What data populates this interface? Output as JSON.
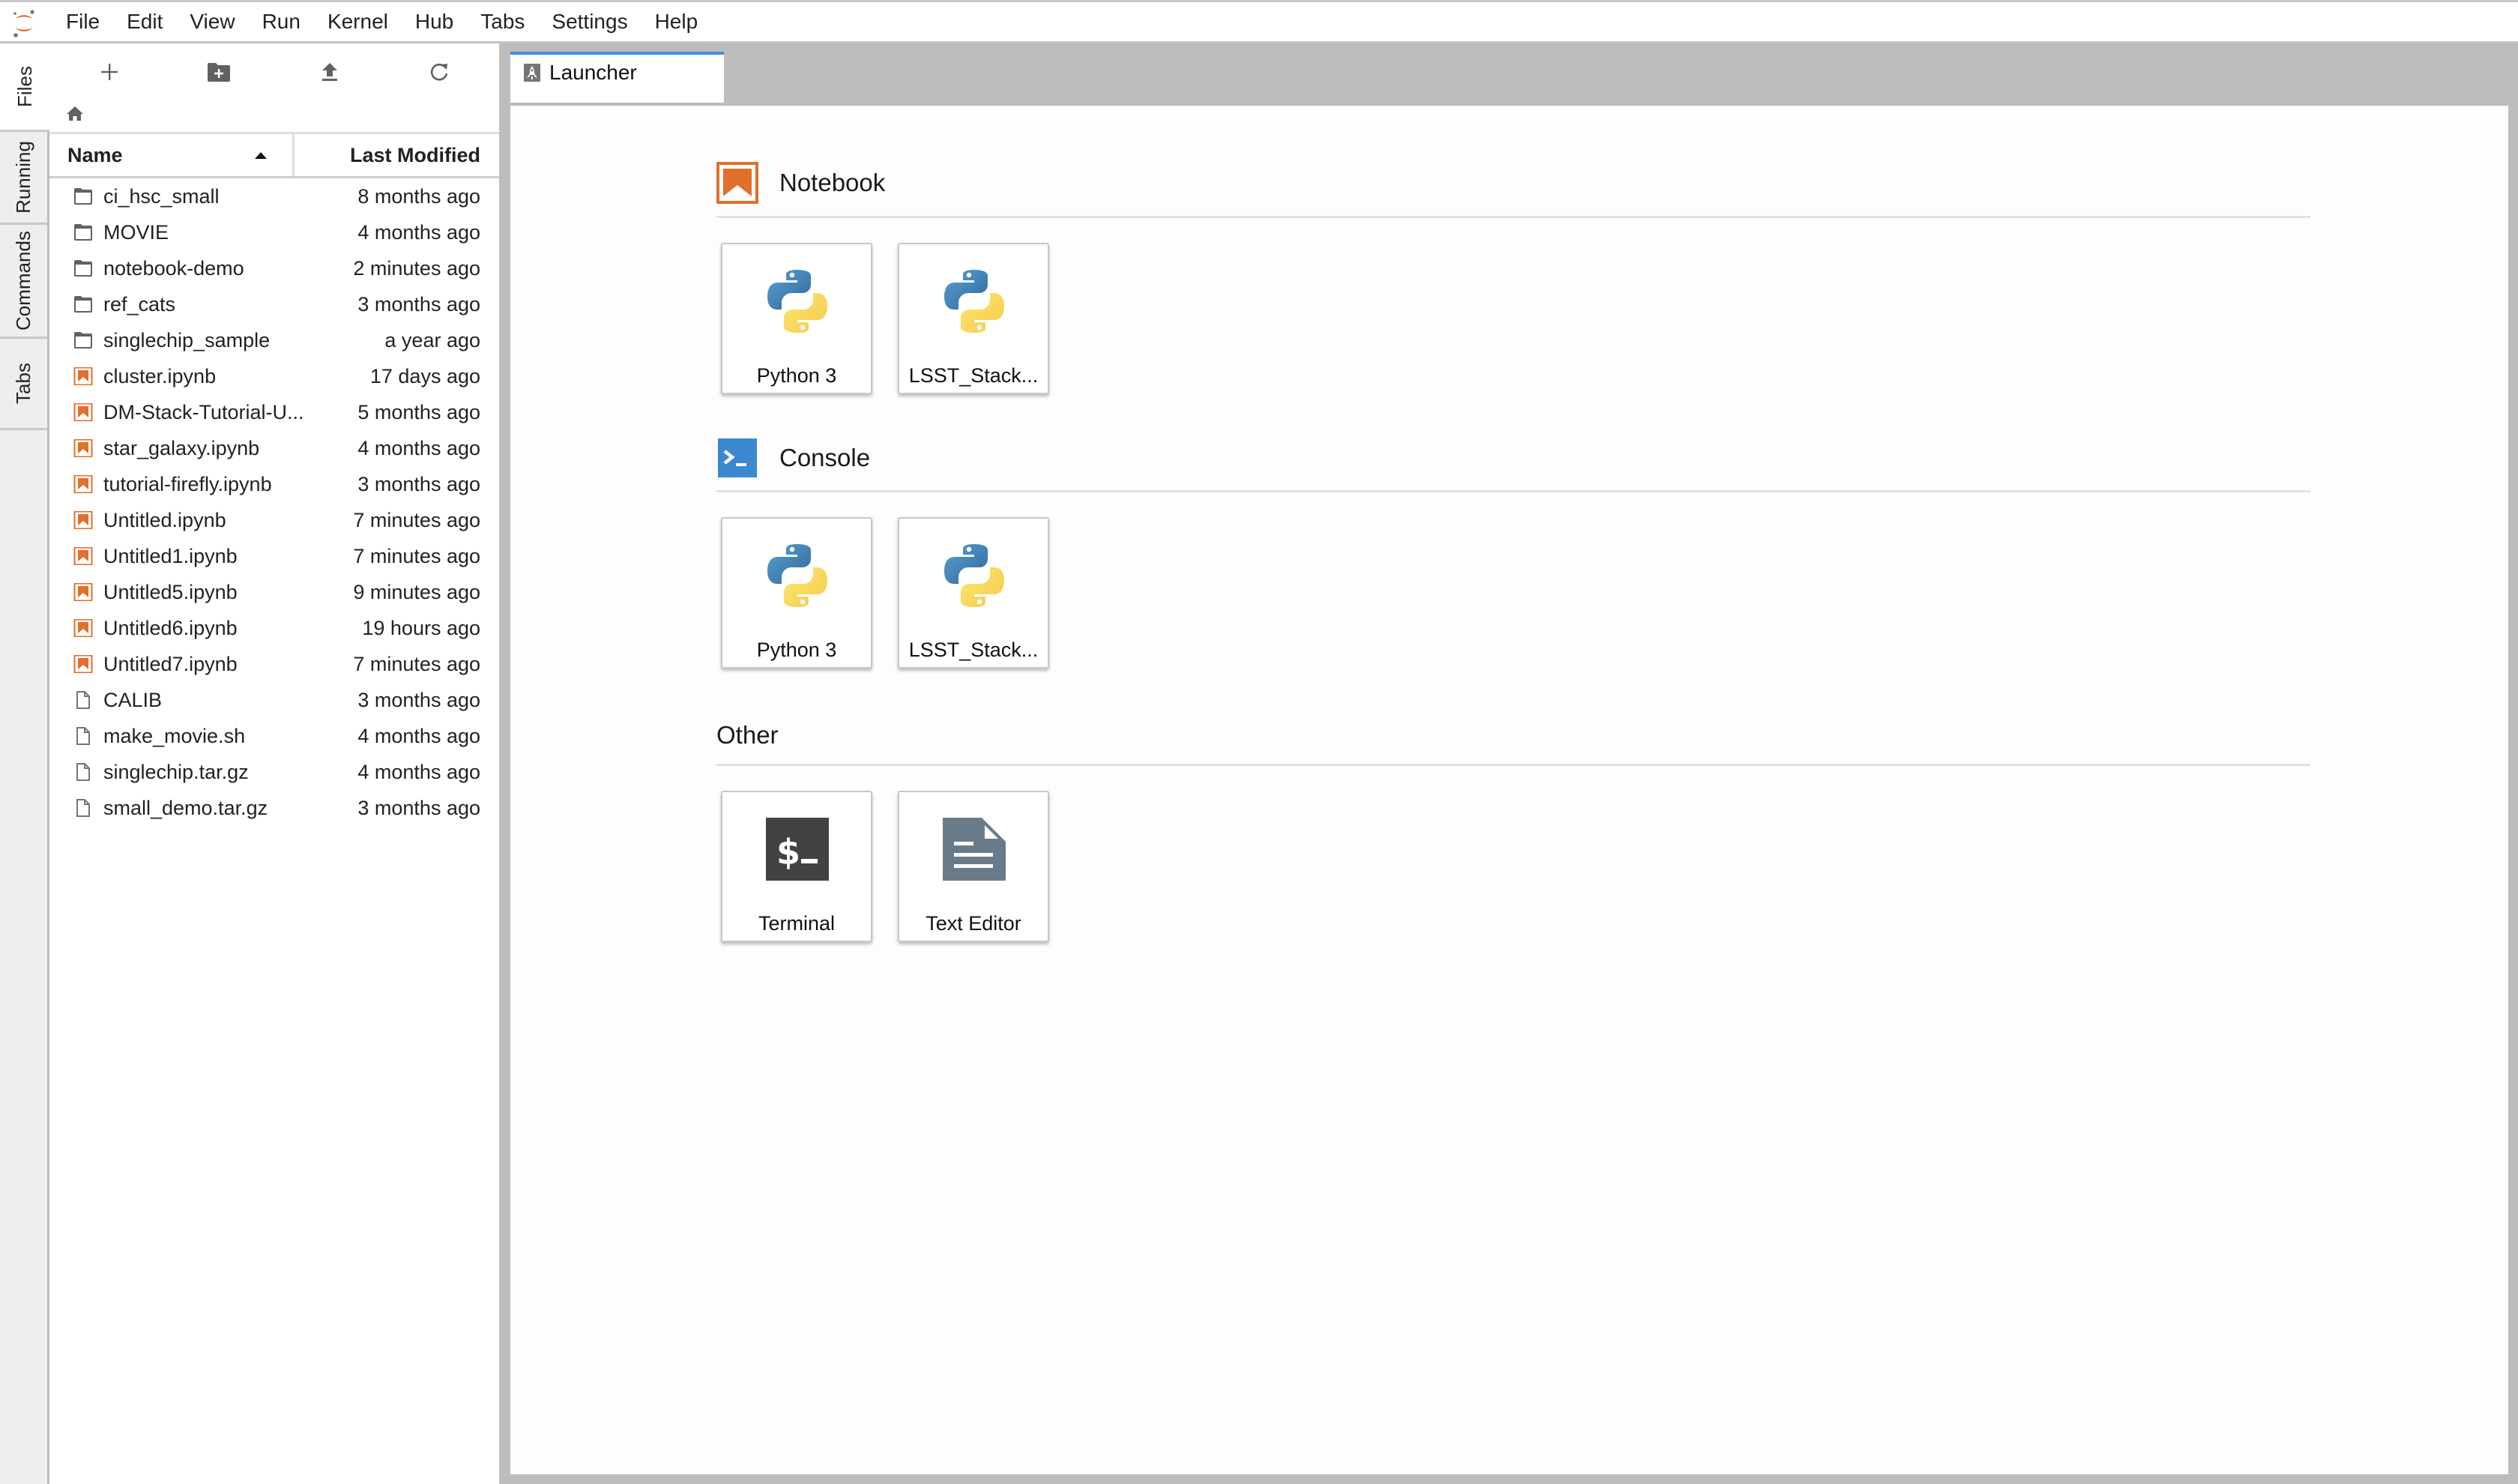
{
  "app": {
    "logo": "jupyter-logo",
    "menu": [
      "File",
      "Edit",
      "View",
      "Run",
      "Kernel",
      "Hub",
      "Tabs",
      "Settings",
      "Help"
    ]
  },
  "side_tabs": [
    {
      "label": "Files",
      "active": true
    },
    {
      "label": "Running",
      "active": false
    },
    {
      "label": "Commands",
      "active": false
    },
    {
      "label": "Tabs",
      "active": false
    }
  ],
  "file_browser": {
    "toolbar": {
      "new_launcher": "plus-icon",
      "new_folder": "new-folder-icon",
      "upload": "upload-icon",
      "refresh": "refresh-icon"
    },
    "breadcrumb": "home-icon",
    "columns": {
      "name": "Name",
      "last_modified": "Last Modified",
      "sort": "ascending"
    },
    "files": [
      {
        "name": "ci_hsc_small",
        "type": "folder",
        "modified": "8 months ago"
      },
      {
        "name": "MOVIE",
        "type": "folder",
        "modified": "4 months ago"
      },
      {
        "name": "notebook-demo",
        "type": "folder",
        "modified": "2 minutes ago"
      },
      {
        "name": "ref_cats",
        "type": "folder",
        "modified": "3 months ago"
      },
      {
        "name": "singlechip_sample",
        "type": "folder",
        "modified": "a year ago"
      },
      {
        "name": "cluster.ipynb",
        "type": "notebook",
        "modified": "17 days ago"
      },
      {
        "name": "DM-Stack-Tutorial-U...",
        "type": "notebook",
        "modified": "5 months ago"
      },
      {
        "name": "star_galaxy.ipynb",
        "type": "notebook",
        "modified": "4 months ago"
      },
      {
        "name": "tutorial-firefly.ipynb",
        "type": "notebook",
        "modified": "3 months ago"
      },
      {
        "name": "Untitled.ipynb",
        "type": "notebook",
        "modified": "7 minutes ago"
      },
      {
        "name": "Untitled1.ipynb",
        "type": "notebook",
        "modified": "7 minutes ago"
      },
      {
        "name": "Untitled5.ipynb",
        "type": "notebook",
        "modified": "9 minutes ago"
      },
      {
        "name": "Untitled6.ipynb",
        "type": "notebook",
        "modified": "19 hours ago"
      },
      {
        "name": "Untitled7.ipynb",
        "type": "notebook",
        "modified": "7 minutes ago"
      },
      {
        "name": "CALIB",
        "type": "file",
        "modified": "3 months ago"
      },
      {
        "name": "make_movie.sh",
        "type": "file",
        "modified": "4 months ago"
      },
      {
        "name": "singlechip.tar.gz",
        "type": "file",
        "modified": "4 months ago"
      },
      {
        "name": "small_demo.tar.gz",
        "type": "file",
        "modified": "3 months ago"
      }
    ]
  },
  "main": {
    "tabs": [
      {
        "label": "Launcher",
        "icon": "rocket-icon",
        "active": true
      }
    ],
    "launcher": {
      "sections": [
        {
          "title": "Notebook",
          "icon": "notebook-icon",
          "items": [
            {
              "label": "Python 3",
              "icon": "python-logo-icon"
            },
            {
              "label": "LSST_Stack...",
              "icon": "python-logo-icon"
            }
          ]
        },
        {
          "title": "Console",
          "icon": "console-icon",
          "items": [
            {
              "label": "Python 3",
              "icon": "python-logo-icon"
            },
            {
              "label": "LSST_Stack...",
              "icon": "python-logo-icon"
            }
          ]
        },
        {
          "title": "Other",
          "icon": null,
          "items": [
            {
              "label": "Terminal",
              "icon": "terminal-icon"
            },
            {
              "label": "Text Editor",
              "icon": "text-editor-icon"
            }
          ]
        }
      ]
    }
  },
  "colors": {
    "accent_blue": "#3f8fe0",
    "notebook_orange": "#e0702a",
    "console_blue": "#3a88d0",
    "terminal_dark": "#424242",
    "editor_slate": "#697b88",
    "panel_gray": "#bdbdbd",
    "sidebar_bg": "#eeeeee"
  }
}
